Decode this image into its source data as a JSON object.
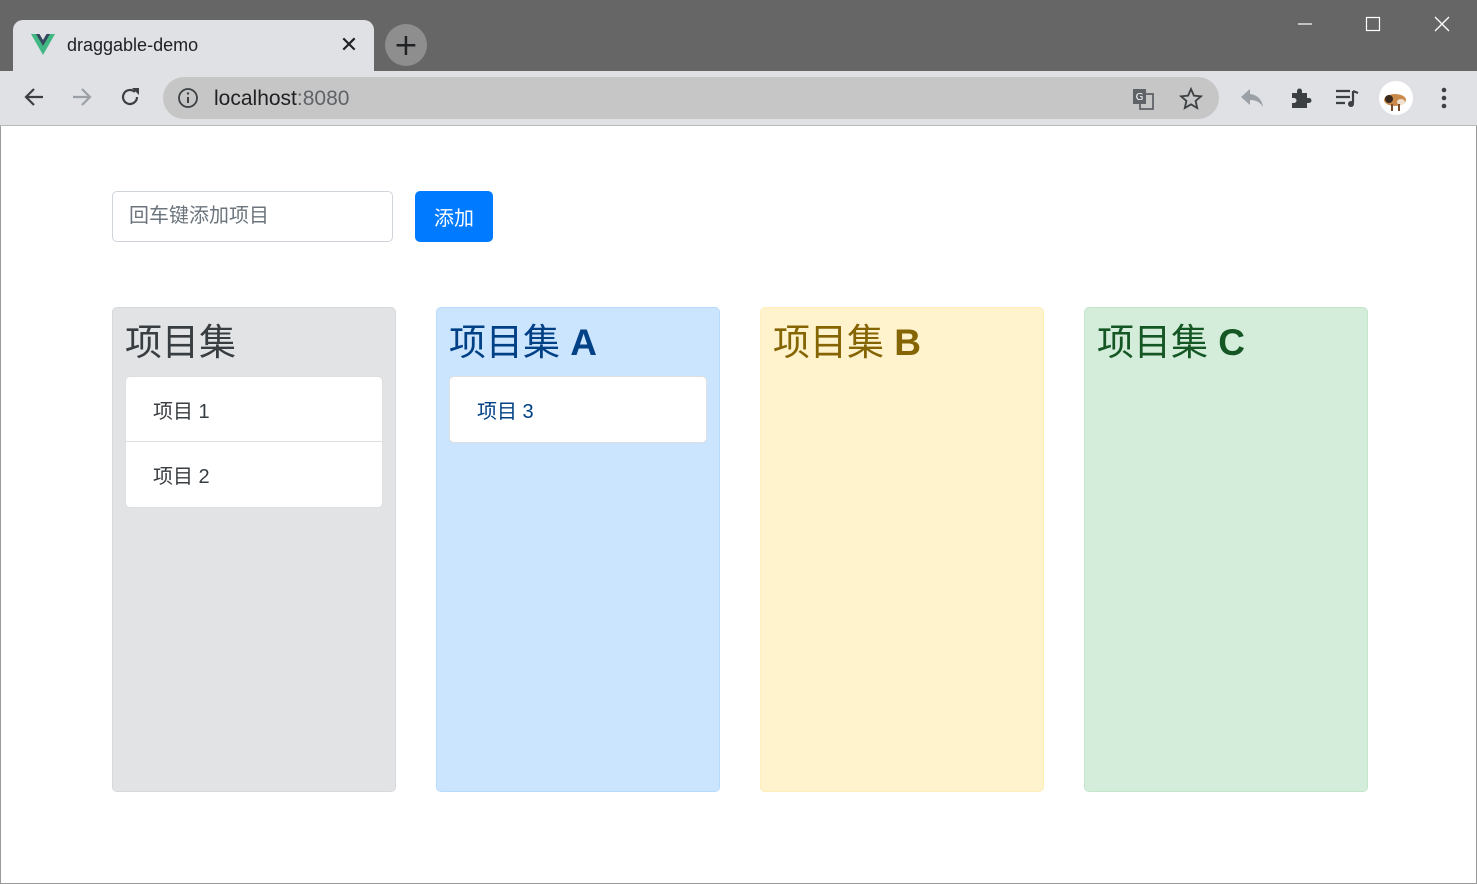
{
  "browser": {
    "tab": {
      "title": "draggable-demo",
      "favicon": "vue-logo-icon",
      "close_glyph": "✕"
    },
    "new_tab_glyph": "+",
    "window_controls": [
      "minimize-icon",
      "maximize-icon",
      "close-icon"
    ],
    "nav": [
      "back-arrow-icon",
      "forward-arrow-icon",
      "reload-icon"
    ],
    "omnibox": {
      "host": "localhost",
      "port": ":8080",
      "info_icon": "info-icon"
    },
    "omnibox_actions": [
      "translate-icon",
      "bookmark-star-icon"
    ],
    "toolbar_actions": [
      "reply-icon",
      "extensions-puzzle-icon",
      "media-queue-icon",
      "profile-avatar",
      "kebab-menu-icon"
    ]
  },
  "form": {
    "placeholder": "回车键添加项目",
    "value": "",
    "add_label": "添加"
  },
  "columns": [
    {
      "title": "项目集",
      "suffix": "",
      "bg": "#e2e3e5",
      "border": "#d6d8db",
      "text": "#383d41",
      "items": [
        "项目 1",
        "项目 2"
      ]
    },
    {
      "title": "项目集",
      "suffix": "A",
      "bg": "#cce5ff",
      "border": "#b8daff",
      "text": "#004085",
      "items": [
        "项目 3"
      ]
    },
    {
      "title": "项目集",
      "suffix": "B",
      "bg": "#fff3cd",
      "border": "#ffeeba",
      "text": "#856404",
      "items": []
    },
    {
      "title": "项目集",
      "suffix": "C",
      "bg": "#d4edda",
      "border": "#c3e6cb",
      "text": "#155724",
      "items": []
    }
  ],
  "colors": {
    "accent": "#007bff",
    "chrome_dark": "#666666",
    "chrome_light": "#dfe1e5"
  }
}
